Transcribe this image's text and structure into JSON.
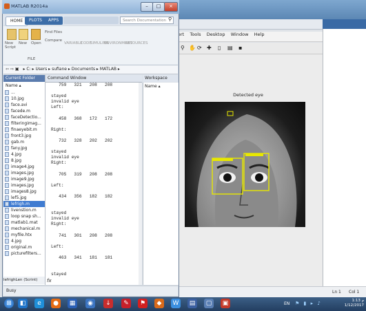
{
  "window": {
    "title": "MATLAB R2014a",
    "minimize": "–",
    "maximize": "□",
    "close": "×"
  },
  "ribbon": {
    "tabs": [
      "HOME",
      "PLOTS",
      "APPS"
    ],
    "search_placeholder": "Search Documentation",
    "buttons": [
      "New Script",
      "New",
      "Open",
      "Find Files",
      "Compare"
    ],
    "sections": [
      "VARIABLE",
      "CODE",
      "SIMULINK",
      "ENVIRONMENT",
      "RESOURCES"
    ],
    "file_section": "FILE"
  },
  "address": {
    "path": "▸ C: ▸ Users ▸ sufiane ▸ Documents ▸ MATLAB ▸"
  },
  "current_folder": {
    "header": "Current Folder",
    "column": "Name ▴",
    "files": [
      "...",
      "10.jpg",
      "face.avi",
      "facede.m",
      "faceDetectio...",
      "filteringimag...",
      "finaeyebit.m",
      "front3.jpg",
      "gab.m",
      "fany.jpg",
      "4.jpg",
      "8.jpg",
      "image4.jpg",
      "images.jpg",
      "image9.jpg",
      "images.jpg",
      "images8.jpg",
      "lef5.jpg",
      "lefrigh.m",
      "livenstion.m",
      "loop snap sh...",
      "matlab1.mat",
      "mechanical.m",
      "myfile.htx",
      "4.jpg",
      "original.m",
      "picturefilters..."
    ],
    "selected_file": "lefrigh.m",
    "footer": "lefrighLen (Scrint)"
  },
  "command_window": {
    "header": "Command Window",
    "lines": [
      "   759   321   208   208",
      "",
      "stayed",
      "invalid eye",
      "Left:",
      "",
      "   458   368   172   172",
      "",
      "Right:",
      "",
      "   732   328   202   202",
      "",
      "stayed",
      "invalid eye",
      "Right:",
      "",
      "   705   319   208   208",
      "",
      "Left:",
      "",
      "   434   356   182   182",
      "",
      "",
      "stayed",
      "invalid eye",
      "Right:",
      "",
      "   741   301   208   208",
      "",
      "Left:",
      "",
      "   463   341   181   181",
      "",
      "",
      "stayed"
    ],
    "prompt": "fx"
  },
  "workspace": {
    "header": "Workspace",
    "column": "Name ▴"
  },
  "status": {
    "left": "Busy",
    "right_ln": "Ln 1",
    "right_col": "Col 1"
  },
  "figure": {
    "menu": [
      "ert",
      "Tools",
      "Desktop",
      "Window",
      "Help"
    ],
    "title": "Detected eye"
  },
  "taskbar": {
    "time": "1:13 ﻡ",
    "date": "1/12/2017",
    "lang": "EN"
  },
  "colors": {
    "detection_box": "#e8e800",
    "title_gradient": "#8eb2d7",
    "taskbar": "#233f61"
  }
}
